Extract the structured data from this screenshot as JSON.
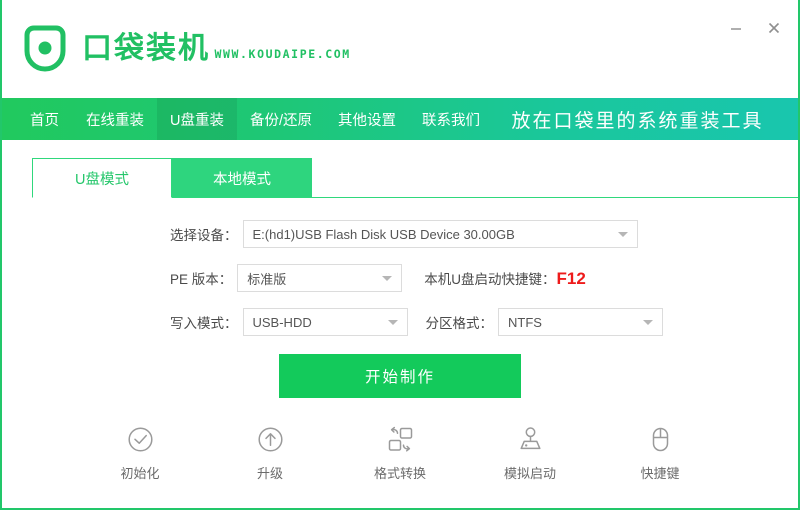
{
  "window": {
    "minimize_label": "−",
    "close_label": "×"
  },
  "brand": {
    "title": "口袋装机",
    "site": "WWW.KOUDAIPE.COM",
    "logo_icon": "pocket-shield-icon",
    "accent_green": "#21c063"
  },
  "nav": {
    "items": [
      {
        "label": "首页",
        "active": false
      },
      {
        "label": "在线重装",
        "active": false
      },
      {
        "label": "U盘重装",
        "active": true
      },
      {
        "label": "备份/还原",
        "active": false
      },
      {
        "label": "其他设置",
        "active": false
      },
      {
        "label": "联系我们",
        "active": false
      }
    ],
    "tagline": "放在口袋里的系统重装工具",
    "gradient_from": "#21c95e",
    "gradient_to": "#19c6ae"
  },
  "tabs": [
    {
      "label": "U盘模式",
      "active": true
    },
    {
      "label": "本地模式",
      "active": false
    }
  ],
  "form": {
    "device": {
      "label": "选择设备：",
      "value": "E:(hd1)USB Flash Disk USB Device 30.00GB"
    },
    "pe_version": {
      "label": "PE 版本：",
      "value": "标准版"
    },
    "hotkey": {
      "label": "本机U盘启动快捷键：",
      "key": "F12",
      "key_color": "#ee1b1b"
    },
    "write_mode": {
      "label": "写入模式：",
      "value": "USB-HDD"
    },
    "partition_format": {
      "label": "分区格式：",
      "value": "NTFS"
    }
  },
  "primary_button": {
    "label": "开始制作",
    "color": "#13ca5b"
  },
  "tools": [
    {
      "label": "初始化",
      "icon": "check-circle-icon"
    },
    {
      "label": "升级",
      "icon": "arrow-up-circle-icon"
    },
    {
      "label": "格式转换",
      "icon": "format-convert-icon"
    },
    {
      "label": "模拟启动",
      "icon": "joystick-icon"
    },
    {
      "label": "快捷键",
      "icon": "mouse-icon"
    }
  ]
}
